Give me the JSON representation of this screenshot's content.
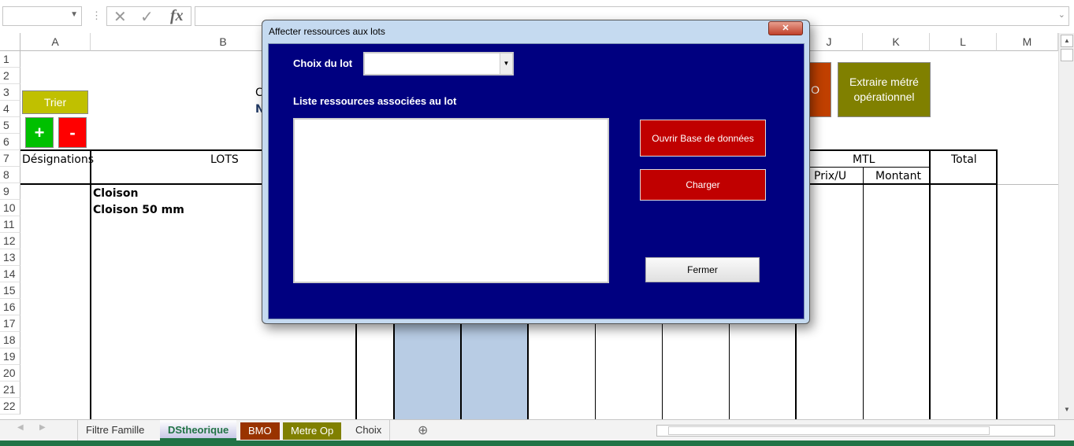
{
  "formula_bar": {
    "name_box": "",
    "cancel_icon": "x-icon",
    "confirm_icon": "check-icon",
    "fx_label": "fx",
    "formula": ""
  },
  "columns": [
    "A",
    "B",
    "J",
    "K",
    "L",
    "M"
  ],
  "rows": [
    "1",
    "2",
    "3",
    "4",
    "5",
    "6",
    "7",
    "8",
    "9",
    "10",
    "11",
    "12",
    "13",
    "14",
    "15",
    "16",
    "17",
    "18",
    "19",
    "20",
    "21",
    "22"
  ],
  "sheet": {
    "trier_label": "Trier",
    "plus_label": "+",
    "minus_label": "-",
    "partial_c": "C",
    "partial_n": "N",
    "partial_orange": "IO",
    "extract_label": "Extraire métré opérationnel",
    "designations": "Désignations",
    "lots": "LOTS",
    "mtl": "MTL",
    "prix_u": "Prix/U",
    "montant": "Montant",
    "total": "Total",
    "cloison": "Cloison",
    "cloison_50": "Cloison 50 mm",
    "colors": {
      "trier": "#c0c000",
      "plus": "#00c000",
      "minus": "#ff0000",
      "orange": "#c04000",
      "extract": "#808000",
      "highlight": "#b8cce4"
    }
  },
  "tabs": [
    {
      "label": "Filtre Famille"
    },
    {
      "label": "DStheorique",
      "active": true
    },
    {
      "label": "BMO",
      "color": "#993300"
    },
    {
      "label": "Metre Op",
      "color": "#808000"
    },
    {
      "label": "Choix"
    }
  ],
  "dialog": {
    "title": "Affecter ressources aux lots",
    "choix_label": "Choix du lot",
    "choix_value": "",
    "liste_label": "Liste ressources associées au lot",
    "open_db": "Ouvrir Base de données",
    "charger": "Charger",
    "fermer": "Fermer",
    "bg": "#000080",
    "button_color": "#c00000"
  }
}
